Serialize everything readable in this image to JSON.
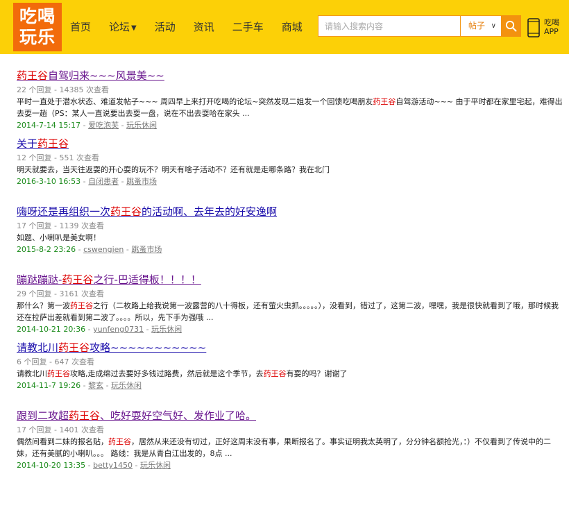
{
  "header": {
    "logo_line1": "吃喝",
    "logo_line2": "玩乐",
    "nav": [
      {
        "label": "首页"
      },
      {
        "label": "论坛"
      },
      {
        "label": "活动"
      },
      {
        "label": "资讯"
      },
      {
        "label": "二手车"
      },
      {
        "label": "商城"
      }
    ],
    "search": {
      "placeholder": "请输入搜索内容",
      "type": "帖子"
    },
    "app_line1": "吃喝",
    "app_line2": "APP"
  },
  "results": [
    {
      "title": [
        "药王谷",
        "自驾归来~~~风景美~~"
      ],
      "meta": "22 个回复 - 14385 次查看",
      "snippet": [
        "平时一直处于潜水状态、难道发帖子~~~ 周四早上来打开吃喝的论坛~突然发现二姐发一个回馈吃喝朋友",
        "药王谷",
        "自驾游活动~~~ 由于平时都在家里宅起，难得出去耍一趟（PS：某人一直说要出去耍一盘，说在不出去耍哈在家头 ..."
      ],
      "date": "2014-7-14 15:17",
      "author": "爱吃泡芙",
      "forum": "玩乐休闲"
    },
    {
      "title": [
        "关于",
        "药王谷"
      ],
      "meta": "12 个回复 - 551 次查看",
      "snippet": [
        "明天就要去，当天往返耍的开心耍的玩不？明天有啥子活动不？还有就是走哪条路？我在北门",
        "",
        ""
      ],
      "date": "2016-3-10 16:53",
      "author": "自闭患者",
      "forum": "跳蚤市场"
    },
    {
      "title": [
        "嗨呀还是再组织一次",
        "药王谷",
        "的活动啊、去年去的好安逸啊"
      ],
      "meta": "17 个回复 - 1139 次查看",
      "snippet": [
        "如题、小喇叭是美女啊！",
        "",
        ""
      ],
      "date": "2015-8-2 23:26",
      "author": "cswengien",
      "forum": "跳蚤市场"
    },
    {
      "title": [
        "蹦跶蹦跶-",
        "药王谷",
        "之行-巴适得板！！！！"
      ],
      "meta": "29 个回复 - 3161 次查看",
      "snippet": [
        "那什么？第一波",
        "药王谷",
        "之行（二枚路上给我说第一波露营的八十得板，还有萤火虫抓。。。。。），没看到，错过了，这第二波，嘿嘿，我是很快就看到了哦，那时候我还在拉萨出差就看到第二波了。。。。所以，先下手为强哦 ..."
      ],
      "date": "2014-10-21 20:36",
      "author": "yunfeng0731",
      "forum": "玩乐休闲"
    },
    {
      "title": [
        "请教北川",
        "药王谷",
        "攻略~~~~~~~~~~~"
      ],
      "meta": "6 个回复 - 647 次查看",
      "snippet": [
        "请教北川",
        "药王谷",
        "攻略,走成绵过去要好多钱过路费，然后就是这个季节，去",
        "药王谷",
        "有耍的吗？谢谢了"
      ],
      "date": "2014-11-7 19:26",
      "author": "黎玄",
      "forum": "玩乐休闲"
    },
    {
      "title": [
        "跟到二攻超",
        "药王谷",
        "、吃好耍好空气好、发作业了哈。"
      ],
      "meta": "17 个回复 - 1401 次查看",
      "snippet": [
        "偶然间看到二妹的报名贴，",
        "药王谷",
        "，居然从来还没有切过，正好这周末没有事，果断报名了。事实证明我太英明了，分分钟名额抢光，：）不仅看到了传说中的二妹，还有美腻的小喇叭。。。 路线：我是从青白江出发的，8点 ..."
      ],
      "date": "2014-10-20 13:35",
      "author": "betty1450",
      "forum": "玩乐休闲"
    }
  ],
  "colors": {
    "header_bg": "#fcd007",
    "logo_bg": "#f26b0b",
    "keyword": "#dd0000",
    "date": "#1a8a1a",
    "link": "#1a0dab",
    "visited": "#68148d"
  }
}
